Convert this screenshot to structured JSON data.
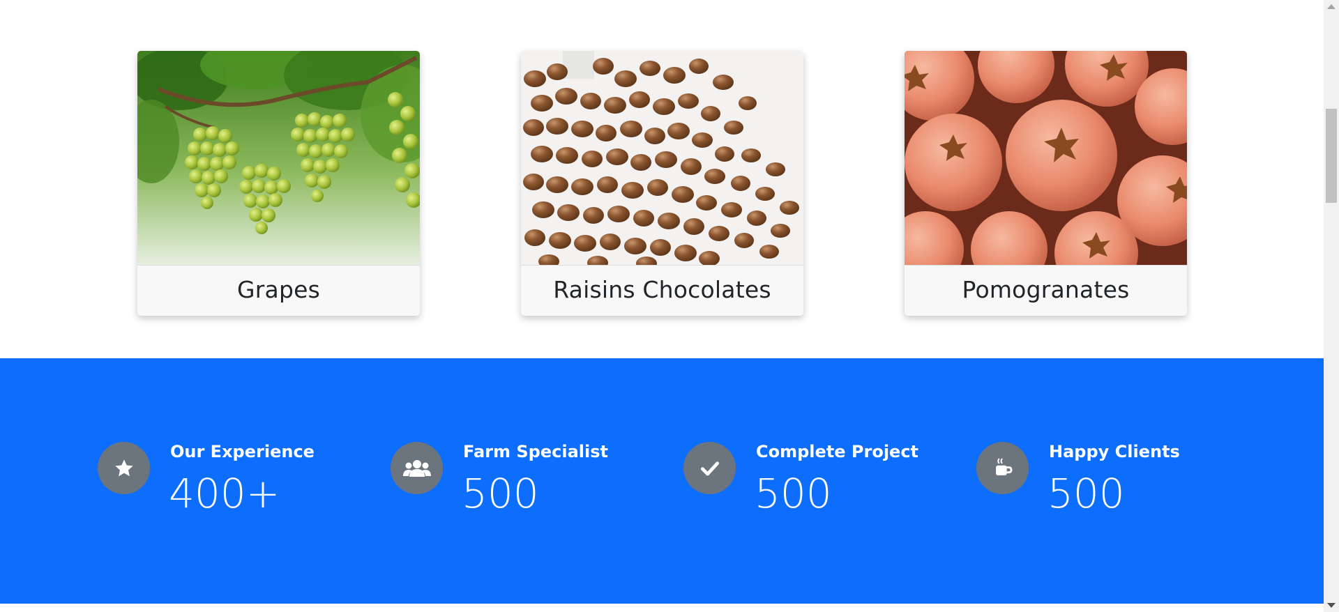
{
  "products": [
    {
      "title": "Grapes",
      "image": "grapes-photo"
    },
    {
      "title": "Raisins Chocolates",
      "image": "chocolate-raisins-photo"
    },
    {
      "title": "Pomogranates",
      "image": "pomegranates-photo"
    }
  ],
  "stats": [
    {
      "label": "Our Experience",
      "value": "400+",
      "icon": "star-icon"
    },
    {
      "label": "Farm Specialist",
      "value": "500",
      "icon": "users-icon"
    },
    {
      "label": "Complete Project",
      "value": "500",
      "icon": "check-icon"
    },
    {
      "label": "Happy Clients",
      "value": "500",
      "icon": "coffee-cup-icon"
    }
  ],
  "colors": {
    "band": "#0d6efd",
    "icon_circle": "#6c757d",
    "card_bg": "#f8f8f8",
    "text_dark": "#212529"
  }
}
